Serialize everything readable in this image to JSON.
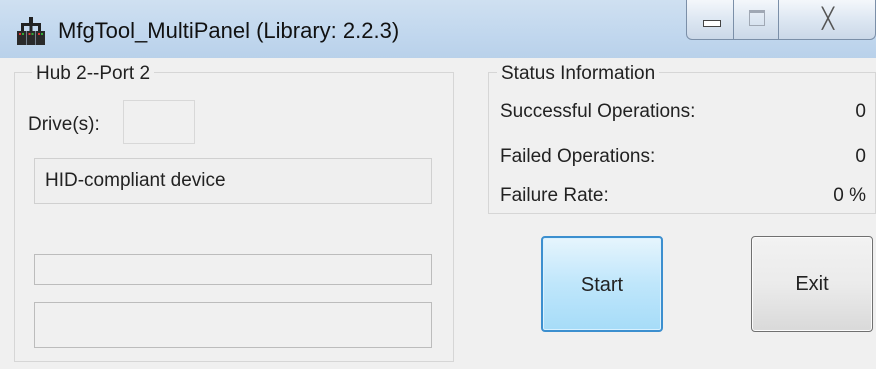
{
  "window": {
    "title": "MfgTool_MultiPanel (Library: 2.2.3)",
    "close_glyph": "╳"
  },
  "hub_panel": {
    "title": "Hub 2--Port 2",
    "drives_label": "Drive(s):",
    "drives_value": "",
    "device_text": "HID-compliant device",
    "progress": 0,
    "message_text": ""
  },
  "status_panel": {
    "title": "Status Information",
    "rows": [
      {
        "label": "Successful Operations:",
        "value": "0"
      },
      {
        "label": "Failed Operations:",
        "value": "0"
      },
      {
        "label": "Failure Rate:",
        "value": "0 %"
      }
    ]
  },
  "buttons": {
    "start_label": "Start",
    "exit_label": "Exit"
  },
  "colors": {
    "titlebar": "#c1d7ee",
    "start_button": "#bfe6fb",
    "progress_fill": "#06b025"
  },
  "icons": {
    "app": "mfgtool-app-icon",
    "minimize": "minimize-icon",
    "maximize": "maximize-icon",
    "close": "close-icon"
  }
}
